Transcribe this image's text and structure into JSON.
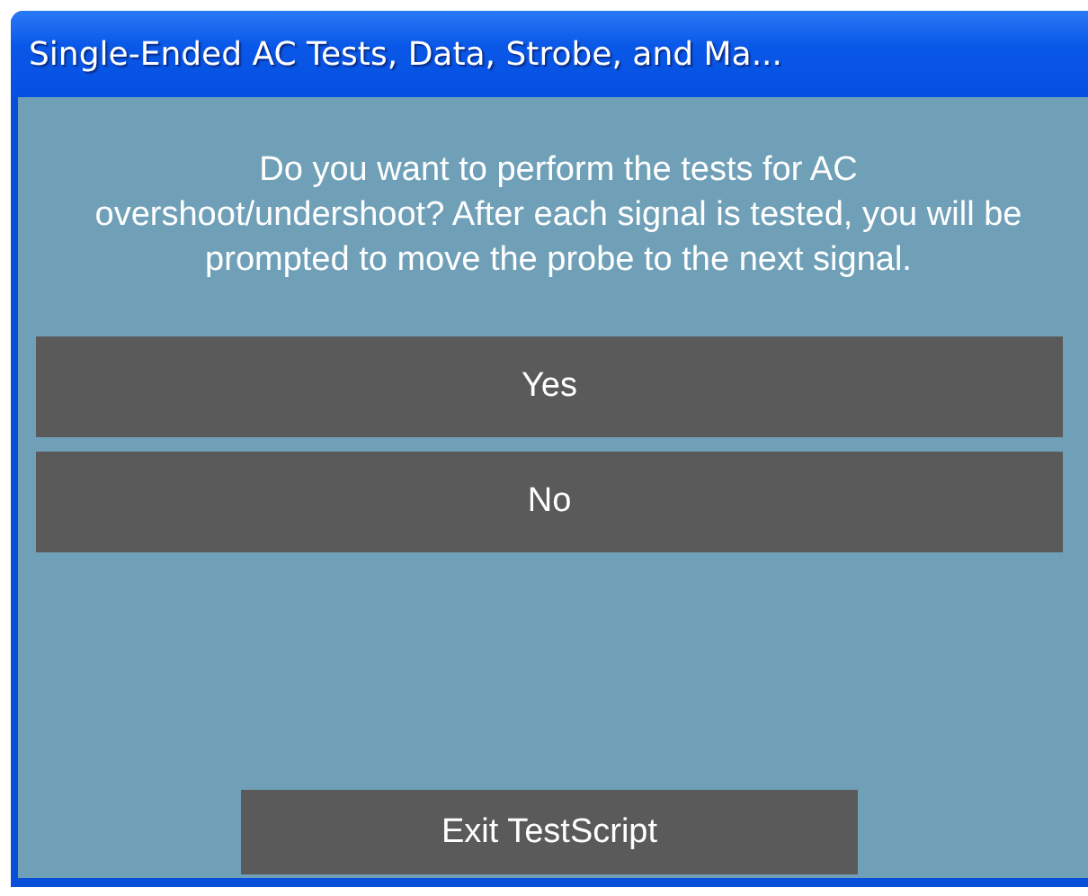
{
  "window": {
    "title": "Single-Ended AC Tests, Data, Strobe, and Ma..."
  },
  "message": "Do you want to perform the tests for AC overshoot/undershoot?  After each signal is tested, you will be prompted to move the probe to the next signal.",
  "choices": [
    "Yes",
    "No"
  ],
  "exit_button": "Exit TestScript"
}
